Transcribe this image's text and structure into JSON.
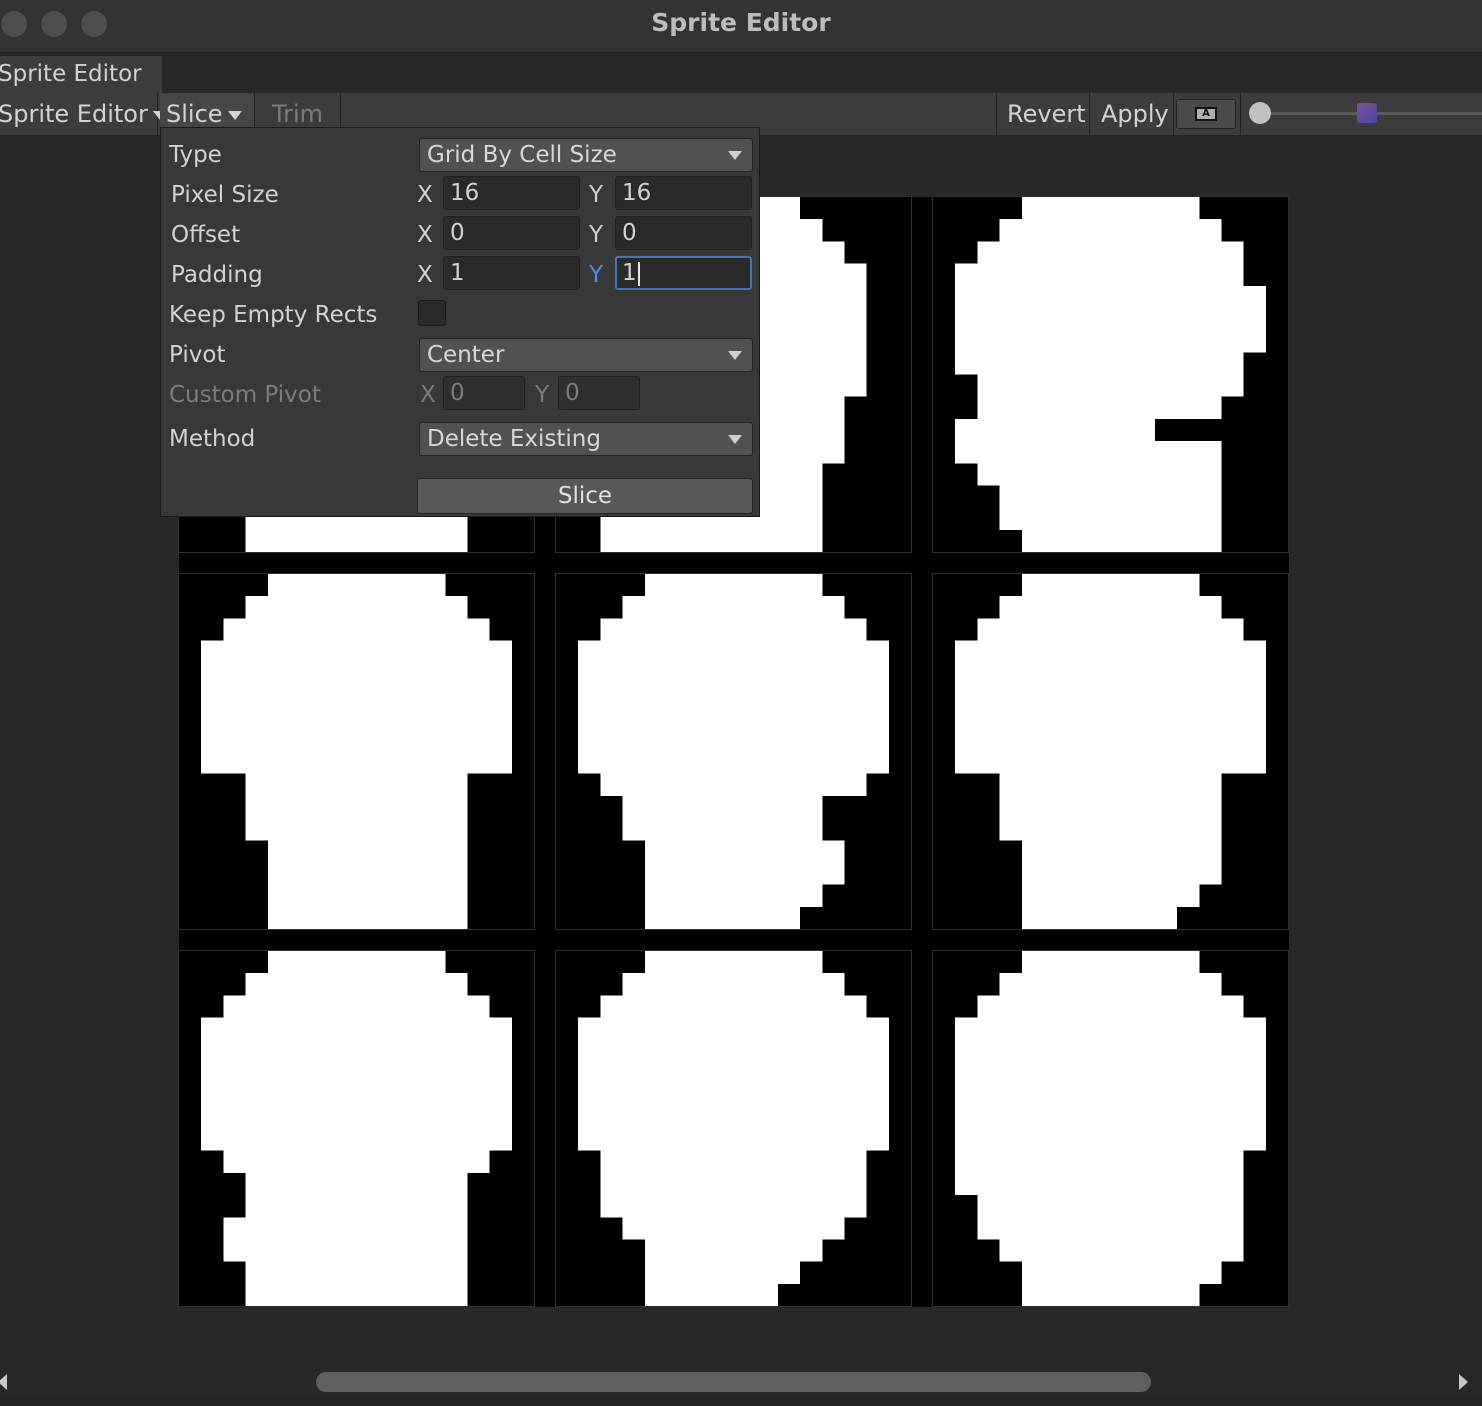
{
  "window": {
    "title": "Sprite Editor"
  },
  "tab": {
    "label": "Sprite Editor"
  },
  "toolbar": {
    "mode_label": "Sprite Editor",
    "slice_label": "Slice",
    "trim_label": "Trim",
    "revert_label": "Revert",
    "apply_label": "Apply",
    "alpha_icon": "alpha-toggle-icon",
    "mip_icon": "mipmap-icon",
    "zoom_level": 0
  },
  "slice_popup": {
    "type_label": "Type",
    "type_value": "Grid By Cell Size",
    "pixel_size_label": "Pixel Size",
    "pixel_size_x": "16",
    "pixel_size_y": "16",
    "offset_label": "Offset",
    "offset_x": "0",
    "offset_y": "0",
    "padding_label": "Padding",
    "padding_x": "1",
    "padding_y": "1",
    "keep_empty_label": "Keep Empty Rects",
    "keep_empty_checked": false,
    "pivot_label": "Pivot",
    "pivot_value": "Center",
    "custom_pivot_label": "Custom Pivot",
    "custom_pivot_x": "0",
    "custom_pivot_y": "0",
    "method_label": "Method",
    "method_value": "Delete Existing",
    "slice_button": "Slice",
    "x_label": "X",
    "y_label": "Y"
  },
  "sprite_sheet": {
    "rows": 3,
    "cols": 3,
    "frames": [
      [
        [
          2,
          13
        ],
        [
          1,
          14
        ],
        [
          0,
          15
        ],
        [
          0,
          15
        ],
        [
          0,
          15
        ],
        [
          0,
          15
        ],
        [
          0,
          15
        ],
        [
          0,
          15
        ],
        [
          1,
          14
        ],
        [
          1,
          14
        ],
        [
          2,
          13
        ],
        [
          2,
          13
        ],
        [
          2,
          13
        ],
        [
          3,
          12
        ],
        [
          3,
          12
        ],
        [
          3,
          12
        ]
      ],
      [
        [
          4,
          10
        ],
        [
          3,
          11
        ],
        [
          2,
          12
        ],
        [
          2,
          13
        ],
        [
          2,
          13
        ],
        [
          2,
          13
        ],
        [
          2,
          13
        ],
        [
          2,
          13
        ],
        [
          2,
          13
        ],
        [
          1,
          12
        ],
        [
          1,
          12
        ],
        [
          2,
          12
        ],
        [
          2,
          11
        ],
        [
          2,
          11
        ],
        [
          2,
          11
        ],
        [
          2,
          11
        ]
      ],
      [
        [
          4,
          11
        ],
        [
          3,
          12
        ],
        [
          2,
          13
        ],
        [
          1,
          13
        ],
        [
          1,
          14
        ],
        [
          1,
          14
        ],
        [
          1,
          14
        ],
        [
          1,
          13
        ],
        [
          2,
          13
        ],
        [
          2,
          12
        ],
        [
          1,
          9
        ],
        [
          1,
          12
        ],
        [
          2,
          12
        ],
        [
          3,
          12
        ],
        [
          3,
          12
        ],
        [
          4,
          12
        ]
      ],
      [
        [
          4,
          11
        ],
        [
          3,
          12
        ],
        [
          2,
          13
        ],
        [
          1,
          14
        ],
        [
          1,
          14
        ],
        [
          1,
          14
        ],
        [
          1,
          14
        ],
        [
          1,
          14
        ],
        [
          1,
          14
        ],
        [
          3,
          12
        ],
        [
          3,
          12
        ],
        [
          3,
          12
        ],
        [
          4,
          12
        ],
        [
          4,
          12
        ],
        [
          4,
          12
        ],
        [
          4,
          12
        ]
      ],
      [
        [
          4,
          11
        ],
        [
          3,
          12
        ],
        [
          2,
          13
        ],
        [
          1,
          14
        ],
        [
          1,
          14
        ],
        [
          1,
          14
        ],
        [
          1,
          14
        ],
        [
          1,
          14
        ],
        [
          1,
          14
        ],
        [
          2,
          13
        ],
        [
          3,
          11
        ],
        [
          3,
          11
        ],
        [
          4,
          12
        ],
        [
          4,
          12
        ],
        [
          4,
          11
        ],
        [
          4,
          10
        ]
      ],
      [
        [
          4,
          11
        ],
        [
          3,
          12
        ],
        [
          2,
          13
        ],
        [
          1,
          14
        ],
        [
          1,
          14
        ],
        [
          1,
          14
        ],
        [
          1,
          14
        ],
        [
          1,
          14
        ],
        [
          1,
          14
        ],
        [
          3,
          12
        ],
        [
          3,
          12
        ],
        [
          3,
          12
        ],
        [
          4,
          12
        ],
        [
          4,
          12
        ],
        [
          4,
          11
        ],
        [
          4,
          10
        ]
      ],
      [
        [
          4,
          11
        ],
        [
          3,
          12
        ],
        [
          2,
          13
        ],
        [
          1,
          14
        ],
        [
          1,
          14
        ],
        [
          1,
          14
        ],
        [
          1,
          14
        ],
        [
          1,
          14
        ],
        [
          1,
          14
        ],
        [
          2,
          13
        ],
        [
          3,
          12
        ],
        [
          3,
          12
        ],
        [
          2,
          12
        ],
        [
          2,
          12
        ],
        [
          3,
          12
        ],
        [
          3,
          12
        ]
      ],
      [
        [
          4,
          11
        ],
        [
          3,
          12
        ],
        [
          2,
          13
        ],
        [
          1,
          14
        ],
        [
          1,
          14
        ],
        [
          1,
          14
        ],
        [
          1,
          14
        ],
        [
          1,
          14
        ],
        [
          1,
          14
        ],
        [
          2,
          13
        ],
        [
          2,
          13
        ],
        [
          2,
          13
        ],
        [
          3,
          12
        ],
        [
          4,
          11
        ],
        [
          4,
          10
        ],
        [
          4,
          9
        ]
      ],
      [
        [
          4,
          11
        ],
        [
          3,
          12
        ],
        [
          2,
          13
        ],
        [
          1,
          14
        ],
        [
          1,
          14
        ],
        [
          1,
          14
        ],
        [
          1,
          14
        ],
        [
          1,
          14
        ],
        [
          1,
          14
        ],
        [
          1,
          13
        ],
        [
          1,
          13
        ],
        [
          2,
          13
        ],
        [
          2,
          13
        ],
        [
          3,
          13
        ],
        [
          4,
          12
        ],
        [
          4,
          11
        ]
      ]
    ],
    "colors": {
      "fg": "#ffffff",
      "bg": "#000000"
    }
  }
}
